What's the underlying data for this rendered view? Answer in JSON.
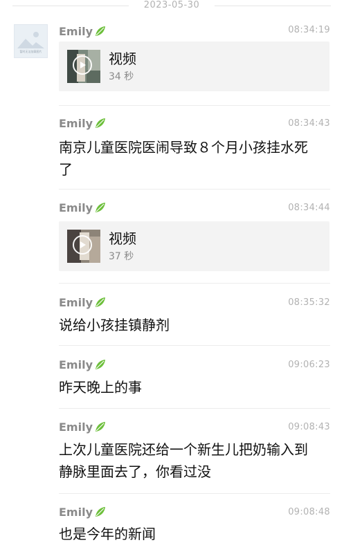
{
  "date_divider": "2023-05-30",
  "avatar": {
    "caption": "暂时无法加载图片"
  },
  "messages": [
    {
      "sender": "Emily",
      "time": "08:34:19",
      "type": "video",
      "video_label": "视频",
      "duration": "34 秒"
    },
    {
      "sender": "Emily",
      "time": "08:34:43",
      "type": "text",
      "lines": [
        "南京儿童医院医闹导致８个月小孩挂水死",
        "了"
      ]
    },
    {
      "sender": "Emily",
      "time": "08:34:44",
      "type": "video",
      "video_label": "视频",
      "duration": "37 秒"
    },
    {
      "sender": "Emily",
      "time": "08:35:32",
      "type": "text",
      "lines": [
        "说给小孩挂镇静剂"
      ]
    },
    {
      "sender": "Emily",
      "time": "09:06:23",
      "type": "text",
      "lines": [
        "昨天晚上的事"
      ]
    },
    {
      "sender": "Emily",
      "time": "09:08:43",
      "type": "text",
      "lines": [
        "上次儿童医院还给一个新生儿把奶输入到",
        "静脉里面去了，你看过没"
      ]
    },
    {
      "sender": "Emily",
      "time": "09:08:48",
      "type": "text",
      "lines": [
        "也是今年的新闻"
      ]
    }
  ],
  "colors": {
    "leaf": "#6cbf3a",
    "sender": "#8a8a8a",
    "time": "#b2b2b2",
    "text": "#111111",
    "card": "#f3f3f3",
    "divider": "#ececec"
  },
  "icons": {
    "sender_badge": "leaf-icon",
    "video_overlay": "play-circle-icon"
  }
}
